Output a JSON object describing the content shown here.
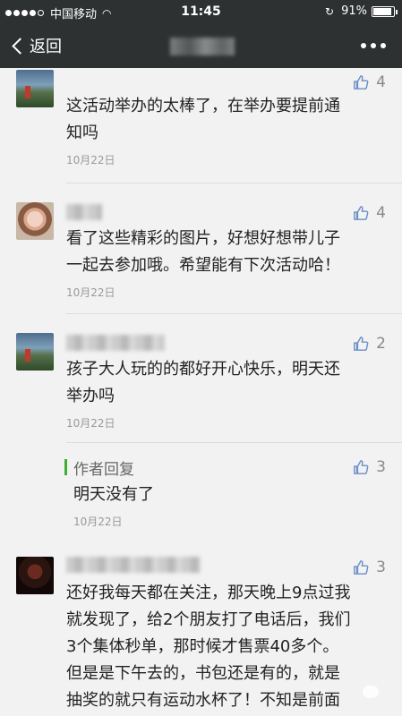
{
  "status": {
    "carrier": "中国移动",
    "time": "11:45",
    "battery": "91%",
    "battery_level": 0.91
  },
  "nav": {
    "back_label": "返回"
  },
  "comments": [
    {
      "text_lines": [
        "这活动举办的太棒了，在举办要提前通",
        "知吗"
      ],
      "date": "10月22日",
      "likes": "4"
    },
    {
      "text_lines": [
        "看了这些精彩的图片，好想好想带儿子",
        "一起去参加哦。希望能有下次活动哈！"
      ],
      "date": "10月22日",
      "likes": "4"
    },
    {
      "text_lines": [
        "孩子大人玩的的都好开心快乐，明天还",
        "举办吗"
      ],
      "date": "10月22日",
      "likes": "2",
      "reply": {
        "label": "作者回复",
        "text": "明天没有了",
        "date": "10月22日",
        "likes": "3"
      }
    },
    {
      "text_lines": [
        "还好我每天都在关注，那天晚上9点过我",
        "就发现了，给2个朋友打了电话后，我们",
        "3个集体秒单，那时候才售票40多个。",
        "但是是下午去的，书包还是有的，就是",
        "抽奖的就只有运动水杯了！不知是前面"
      ],
      "likes": "3"
    }
  ],
  "colors": {
    "bar": "#2e3132",
    "accent": "#3cb035",
    "like_icon": "#6b8fc9"
  },
  "icons": {
    "back": "chevron-left-icon",
    "more": "more-dots-icon",
    "like": "thumbs-up-icon"
  }
}
